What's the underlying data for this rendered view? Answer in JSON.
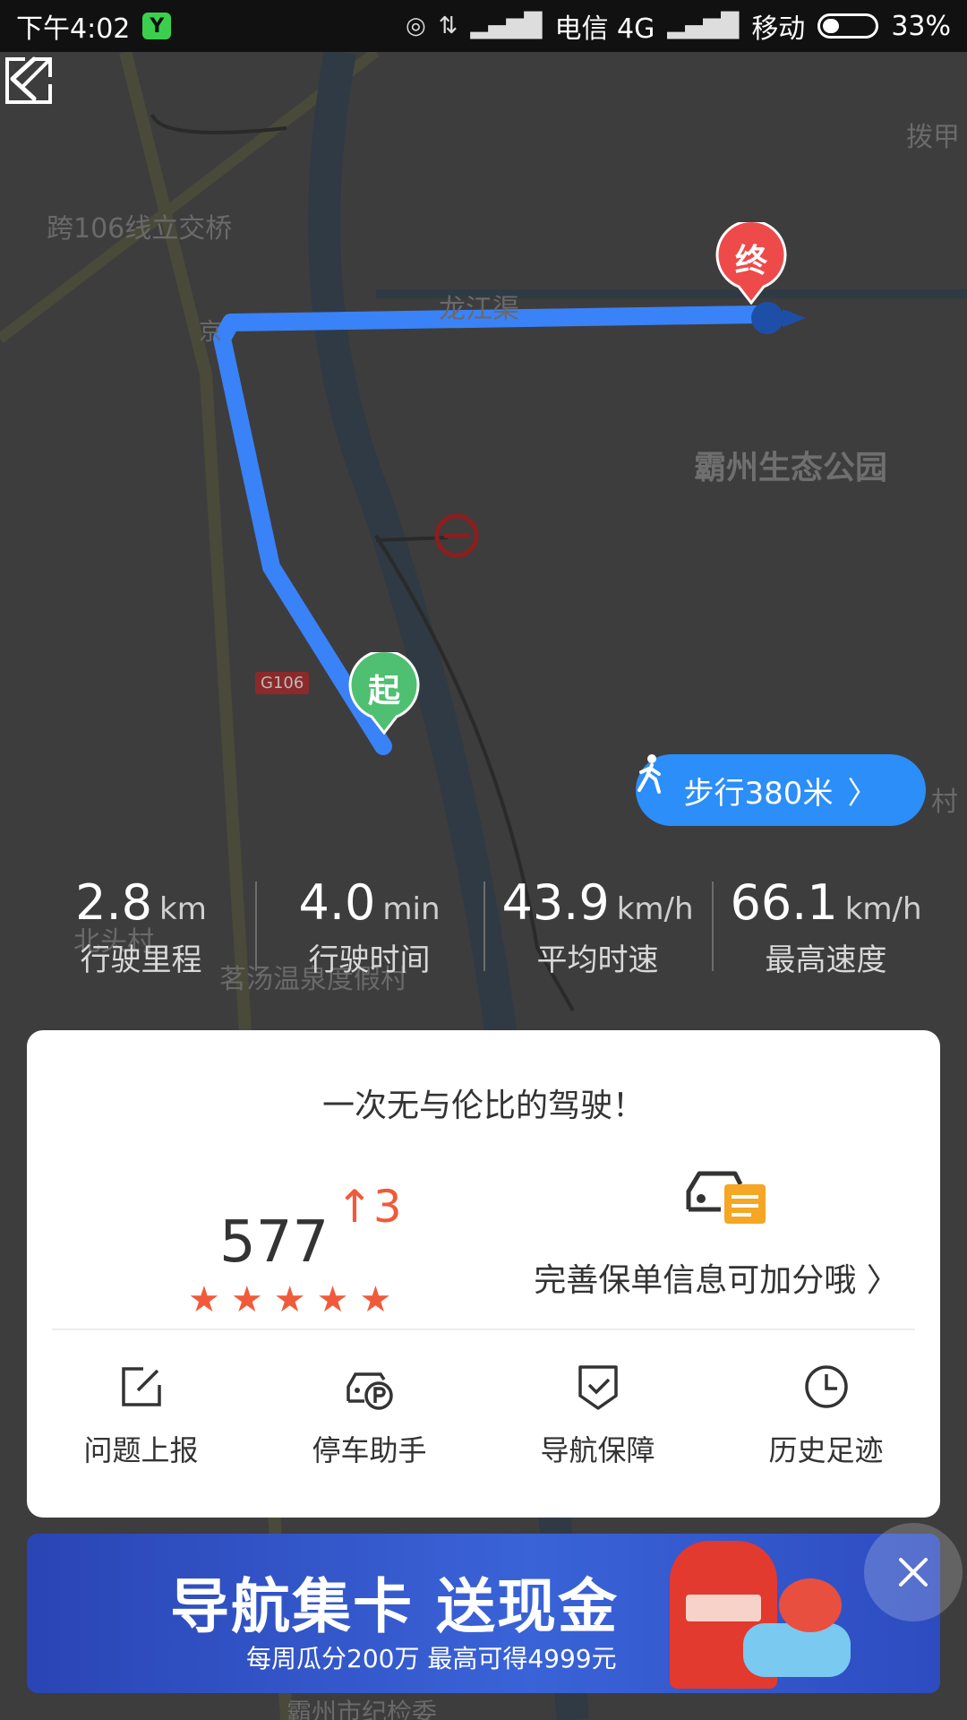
{
  "status_bar": {
    "time": "下午4:02",
    "app_badge": "Y",
    "carrier_1": "电信 4G",
    "carrier_2": "移动",
    "battery": "33%",
    "battery_level": 0.33
  },
  "map": {
    "labels": {
      "interchange": "跨106线立交桥",
      "river": "龙江渠",
      "park": "霸州生态公园",
      "road_code": "G106",
      "village_bottom": "北头村",
      "resort": "茗汤温泉度假村",
      "bottom": "霸州市纪检委",
      "edge_top_right": "拨甲",
      "edge_right": "村",
      "jing": "京"
    },
    "start_pin": "起",
    "end_pin": "终",
    "walk_button": "步行380米"
  },
  "stats": [
    {
      "value": "2.8",
      "unit": "km",
      "label": "行驶里程"
    },
    {
      "value": "4.0",
      "unit": "min",
      "label": "行驶时间"
    },
    {
      "value": "43.9",
      "unit": "km/h",
      "label": "平均时速"
    },
    {
      "value": "66.1",
      "unit": "km/h",
      "label": "最高速度"
    }
  ],
  "card": {
    "title": "一次无与伦比的驾驶！",
    "score": "577",
    "score_change": "↑3",
    "star_rating": 5,
    "policy_text": "完善保单信息可加分哦 〉",
    "actions": [
      {
        "label": "问题上报",
        "icon": "edit-icon"
      },
      {
        "label": "停车助手",
        "icon": "parking-car-icon"
      },
      {
        "label": "导航保障",
        "icon": "shield-check-icon"
      },
      {
        "label": "历史足迹",
        "icon": "clock-icon"
      }
    ]
  },
  "banner": {
    "title": "导航集卡 送现金",
    "subtitle": "每周瓜分200万   最高可得4999元"
  },
  "colors": {
    "route_blue": "#3a82f7",
    "start_green": "#4fbf72",
    "end_red": "#ee4a4a",
    "accent_orange": "#f05a3a",
    "walk_blue": "#2c8ef8"
  }
}
